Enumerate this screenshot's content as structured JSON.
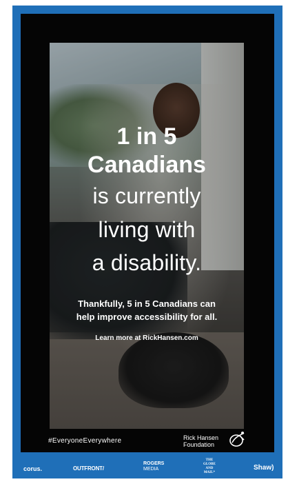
{
  "ad": {
    "headline_line1": "1 in 5",
    "headline_line2": "Canadians",
    "headline_line3": "is currently",
    "headline_line4": "living with",
    "headline_line5": "a disability.",
    "subtext_line1": "Thankfully, 5 in 5 Canadians can",
    "subtext_line2": "help improve accessibility for all.",
    "cta": "Learn more at RickHansen.com",
    "hashtag": "#EveryoneEverywhere",
    "foundation_line1": "Rick Hansen",
    "foundation_line2": "Foundation"
  },
  "sponsors": {
    "corus": "corus.",
    "outfront": "OUTFRONT/",
    "rogers_line1": "ROGERS",
    "rogers_line2": "MEDIA",
    "globe_line1": "THE",
    "globe_line2": "GLOBE",
    "globe_line3": "AND",
    "globe_line4": "MAIL*",
    "shaw": "Shaw)"
  },
  "colors": {
    "border_blue": "#1f6fb8",
    "panel_black": "#050505",
    "text_white": "#ffffff"
  }
}
